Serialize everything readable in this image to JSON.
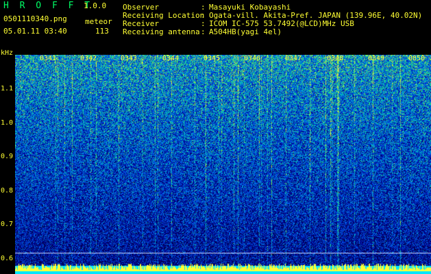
{
  "header": {
    "app_title": "H R O F F T",
    "app_version": "1.0.0",
    "file_name": "0501110340.png",
    "meteor_label": "meteor",
    "datetime": "05.01.11 03:40",
    "meteor_count": "113"
  },
  "info": {
    "observer_label": "Observer",
    "observer_value": "Masayuki Kobayashi",
    "location_label": "Receiving Location",
    "location_value": "Ogata-vill. Akita-Pref. JAPAN (139.96E, 40.02N)",
    "receiver_label": "Receiver",
    "receiver_value": "ICOM IC-575 53.7492(@LCD)MHz USB",
    "antenna_label": "Receiving antenna",
    "antenna_value": "A504HB(yagi 4el)",
    "colon": ":"
  },
  "spectrogram": {
    "y_unit": "kHz",
    "y_ticks": [
      "1.1",
      "1.0",
      "0.9",
      "0.8",
      "0.7",
      "0.6"
    ],
    "time_ticks": [
      "0341",
      "0342",
      "0343",
      "0344",
      "0345",
      "0346",
      "0347",
      "0348",
      "0349",
      "0850"
    ]
  }
}
